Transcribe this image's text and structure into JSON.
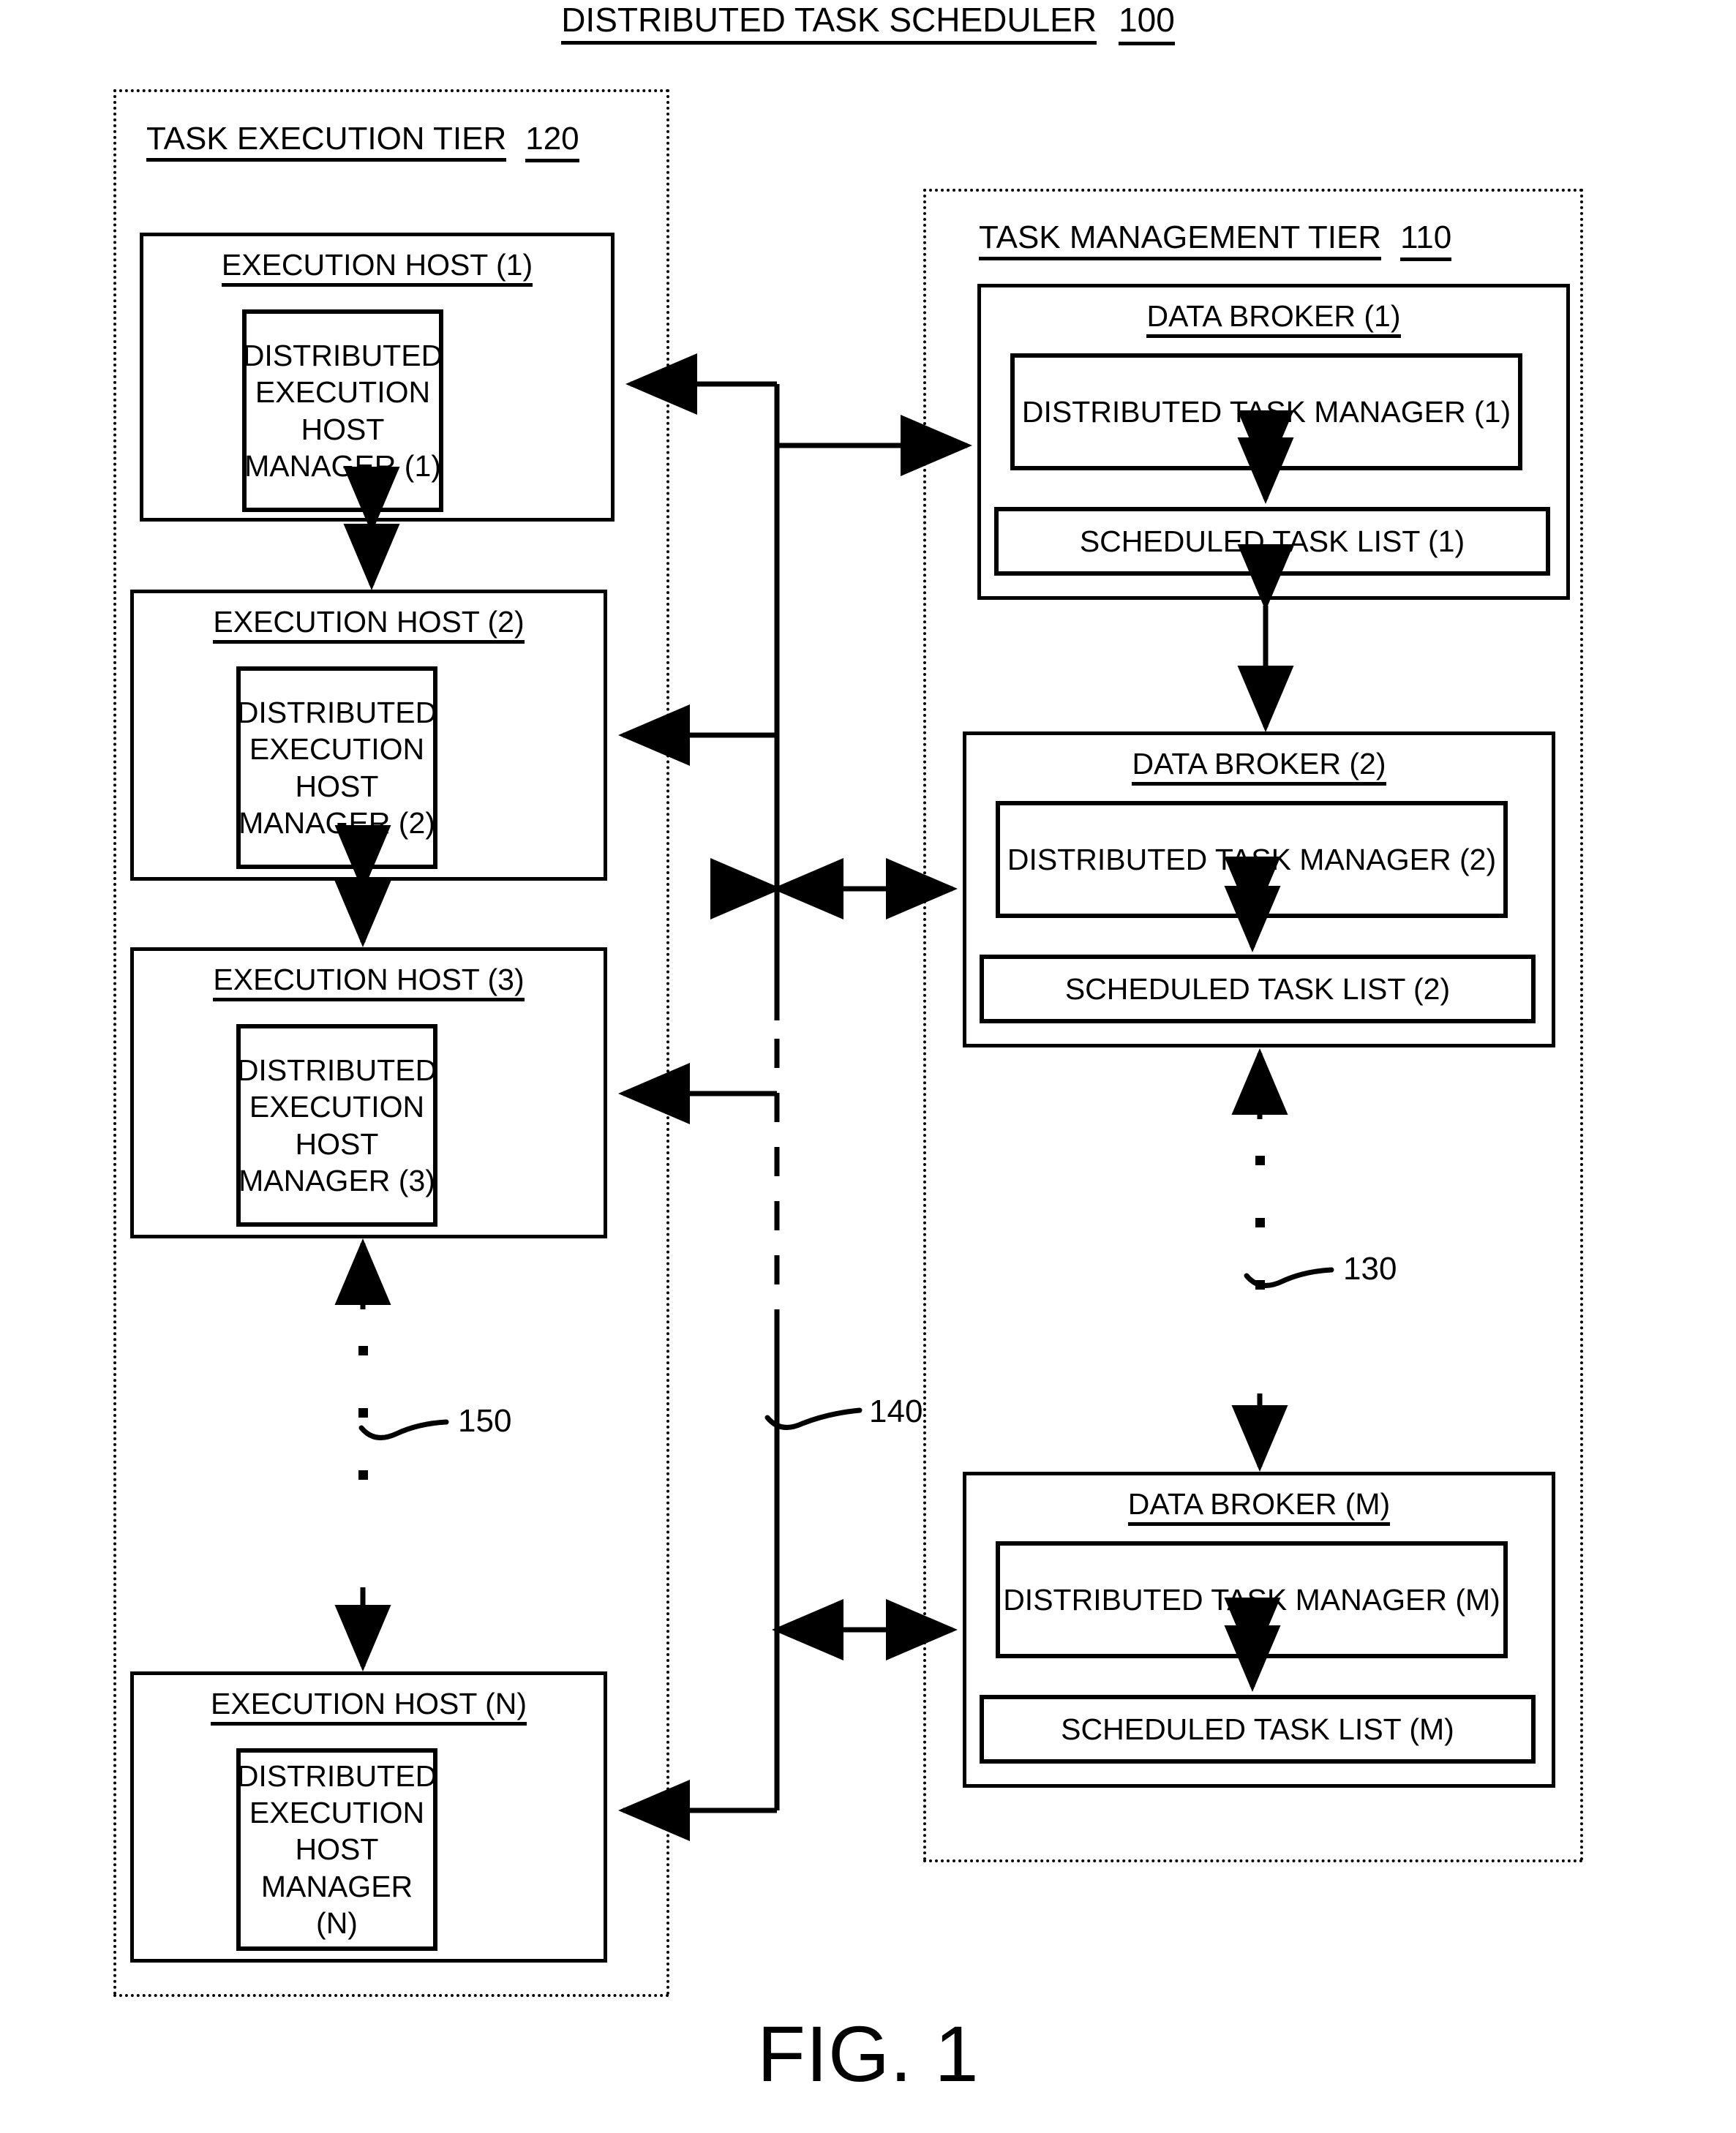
{
  "figure": {
    "title": "DISTRIBUTED TASK SCHEDULER",
    "title_ref": "100",
    "caption": "FIG. 1"
  },
  "tiers": [
    {
      "id": "task-execution-tier",
      "label": "TASK EXECUTION TIER",
      "ref": "120"
    },
    {
      "id": "task-management-tier",
      "label": "TASK MANAGEMENT TIER",
      "ref": "110"
    }
  ],
  "execution_hosts": [
    {
      "title": "EXECUTION HOST (1)",
      "manager": "DISTRIBUTED EXECUTION HOST MANAGER (1)"
    },
    {
      "title": "EXECUTION HOST (2)",
      "manager": "DISTRIBUTED EXECUTION HOST MANAGER (2)"
    },
    {
      "title": "EXECUTION HOST (3)",
      "manager": "DISTRIBUTED EXECUTION HOST MANAGER (3)"
    },
    {
      "title": "EXECUTION HOST (N)",
      "manager": "DISTRIBUTED EXECUTION HOST MANAGER (N)"
    }
  ],
  "data_brokers": [
    {
      "title": "DATA BROKER (1)",
      "manager": "DISTRIBUTED TASK MANAGER (1)",
      "task_list": "SCHEDULED TASK LIST (1)"
    },
    {
      "title": "DATA BROKER (2)",
      "manager": "DISTRIBUTED TASK MANAGER (2)",
      "task_list": "SCHEDULED TASK LIST (2)"
    },
    {
      "title": "DATA BROKER (M)",
      "manager": "DISTRIBUTED TASK MANAGER (M)",
      "task_list": "SCHEDULED TASK LIST (M)"
    }
  ],
  "reference_numerals": {
    "broker_chain": "130",
    "network": "140",
    "host_chain": "150"
  },
  "colors": {
    "ink": "#000000",
    "paper": "#ffffff"
  }
}
